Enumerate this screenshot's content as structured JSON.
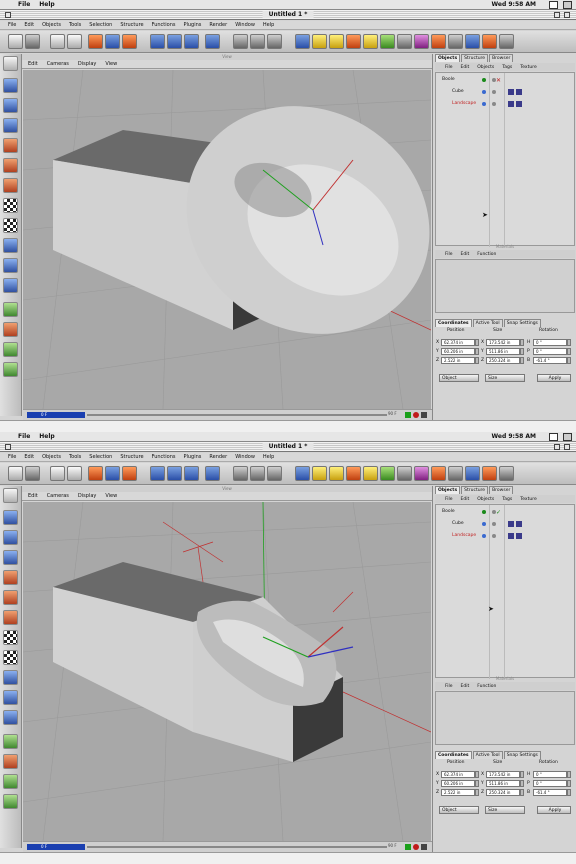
{
  "menubar": {
    "apple": "",
    "items": [
      "File",
      "Help"
    ],
    "clock": "Wed 9:58 AM"
  },
  "window": {
    "title": "Untitled 1 *"
  },
  "appmenu": [
    "File",
    "Edit",
    "Objects",
    "Tools",
    "Selection",
    "Structure",
    "Functions",
    "Plugins",
    "Render",
    "Window",
    "Help"
  ],
  "view": {
    "strip_label": "View",
    "menu": [
      "Edit",
      "Cameras",
      "Display",
      "View"
    ]
  },
  "timeline": {
    "frame": "0 F",
    "end": "90 F"
  },
  "panels": {
    "tabs": [
      "Objects",
      "Structure",
      "Browser"
    ],
    "obj_menu": [
      "File",
      "Edit",
      "Objects",
      "Tags",
      "Texture"
    ],
    "objects": [
      {
        "name": "Boole",
        "color": "#111111",
        "state": "x"
      },
      {
        "name": "Cube",
        "color": "#111111"
      },
      {
        "name": "Landscape",
        "color": "#c02020"
      }
    ],
    "objects2_state": "check",
    "materials_label": "Materials",
    "mat_menu": [
      "File",
      "Edit",
      "Function"
    ],
    "coord_tabs": [
      "Coordinates",
      "Active Tool",
      "Snap Settings"
    ],
    "coord_header": [
      "Position",
      "Size",
      "Rotation"
    ],
    "coords": [
      {
        "axis": "X",
        "pos": "62.374 in",
        "saxis": "X",
        "size": "173.542 in",
        "raxis": "H",
        "rot": "0 °"
      },
      {
        "axis": "Y",
        "pos": "60.206 in",
        "saxis": "Y",
        "size": "511.86 in",
        "raxis": "P",
        "rot": "0 °"
      },
      {
        "axis": "Z",
        "pos": "2.522 in",
        "saxis": "Z",
        "size": "250.324 in",
        "raxis": "B",
        "rot": "-61.4 °"
      }
    ],
    "bottom": {
      "object": "Object",
      "size": "Size",
      "apply": "Apply"
    }
  },
  "colors": {
    "frame_blue": "#1a3fb0",
    "viewport_bg": "#a8a8a8",
    "cube_top": "#6a6a6a",
    "cube_front": "#d2d2d2",
    "cube_side": "#3a3a3a"
  }
}
